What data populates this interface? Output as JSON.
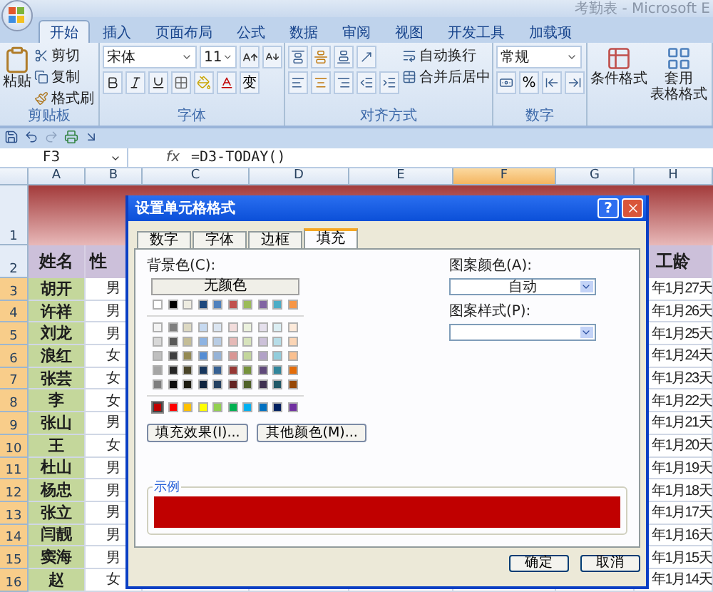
{
  "window": {
    "title": "考勤表 - Microsoft E"
  },
  "ribbon_tabs": [
    {
      "label": "开始",
      "selected": true
    },
    {
      "label": "插入",
      "selected": false
    },
    {
      "label": "页面布局",
      "selected": false
    },
    {
      "label": "公式",
      "selected": false
    },
    {
      "label": "数据",
      "selected": false
    },
    {
      "label": "审阅",
      "selected": false
    },
    {
      "label": "视图",
      "selected": false
    },
    {
      "label": "开发工具",
      "selected": false
    },
    {
      "label": "加载项",
      "selected": false
    }
  ],
  "ribbon": {
    "clipboard": {
      "paste": "粘贴",
      "cut": "剪切",
      "copy": "复制",
      "format_painter": "格式刷",
      "label": "剪贴板"
    },
    "font": {
      "name": "宋体",
      "size": "11",
      "phonetic": "变",
      "label": "字体"
    },
    "alignment": {
      "wrap": "自动换行",
      "merge": "合并后居中",
      "label": "对齐方式"
    },
    "number": {
      "format": "常规",
      "percent": "%",
      "label": "数字"
    },
    "styles": {
      "conditional": "条件格式",
      "table_format": [
        "套用",
        "表格格式"
      ]
    }
  },
  "formula_bar": {
    "cell": "F3",
    "fx": "fx",
    "formula": "=D3-TODAY()"
  },
  "columns": [
    {
      "label": "A",
      "selected": false
    },
    {
      "label": "B",
      "selected": false
    },
    {
      "label": "C",
      "selected": false
    },
    {
      "label": "D",
      "selected": false
    },
    {
      "label": "E",
      "selected": false
    },
    {
      "label": "F",
      "selected": true
    },
    {
      "label": "G",
      "selected": false
    },
    {
      "label": "H",
      "selected": false
    }
  ],
  "title_row": {
    "number": "1"
  },
  "header_row": {
    "number": "2",
    "name": "姓名",
    "gender": "性",
    "tenure": "工龄"
  },
  "rows": [
    {
      "number": "3",
      "selected": true,
      "name": "胡开",
      "gender": "男",
      "tenure": "年1月27天"
    },
    {
      "number": "4",
      "selected": true,
      "name": "许祥",
      "gender": "男",
      "tenure": "年1月26天"
    },
    {
      "number": "5",
      "selected": true,
      "name": "刘龙",
      "gender": "男",
      "tenure": "年1月25天"
    },
    {
      "number": "6",
      "selected": true,
      "name": "浪红",
      "gender": "女",
      "tenure": "年1月24天"
    },
    {
      "number": "7",
      "selected": true,
      "name": "张芸",
      "gender": "女",
      "tenure": "年1月23天"
    },
    {
      "number": "8",
      "selected": true,
      "name": "李",
      "gender": "女",
      "tenure": "年1月22天"
    },
    {
      "number": "9",
      "selected": true,
      "name": "张山",
      "gender": "男",
      "tenure": "年1月21天"
    },
    {
      "number": "10",
      "selected": true,
      "name": "王",
      "gender": "女",
      "tenure": "年1月20天"
    },
    {
      "number": "11",
      "selected": true,
      "name": "杜山",
      "gender": "男",
      "tenure": "年1月19天"
    },
    {
      "number": "12",
      "selected": true,
      "name": "杨忠",
      "gender": "男",
      "tenure": "年1月18天"
    },
    {
      "number": "13",
      "selected": true,
      "name": "张立",
      "gender": "男",
      "tenure": "年1月17天"
    },
    {
      "number": "14",
      "selected": true,
      "name": "闫靓",
      "gender": "男",
      "tenure": "年1月16天"
    },
    {
      "number": "15",
      "selected": true,
      "name": "窦海",
      "gender": "男",
      "tenure": "年1月15天"
    },
    {
      "number": "16",
      "selected": true,
      "name": "赵",
      "gender": "女",
      "tenure": "年1月14天"
    }
  ],
  "dialog": {
    "title": "设置单元格格式",
    "help": "?",
    "tabs": [
      {
        "label": "数字",
        "selected": false
      },
      {
        "label": "字体",
        "selected": false
      },
      {
        "label": "边框",
        "selected": false
      },
      {
        "label": "填充",
        "selected": true
      }
    ],
    "background_label": "背景色(C):",
    "no_color": "无颜色",
    "theme_colors": [
      {
        "color": "#ffffff"
      },
      {
        "color": "#000000"
      },
      {
        "color": "#eeece1"
      },
      {
        "color": "#1f497d"
      },
      {
        "color": "#4f81bd"
      },
      {
        "color": "#c0504d"
      },
      {
        "color": "#9bbb59"
      },
      {
        "color": "#8064a2"
      },
      {
        "color": "#4bacc6"
      },
      {
        "color": "#f79646"
      }
    ],
    "tint_colors": [
      {
        "color": "#f2f2f2"
      },
      {
        "color": "#7f7f7f"
      },
      {
        "color": "#ddd9c3"
      },
      {
        "color": "#c6d9f0"
      },
      {
        "color": "#dbe5f1"
      },
      {
        "color": "#f2dcdb"
      },
      {
        "color": "#ebf1dd"
      },
      {
        "color": "#e5e0ec"
      },
      {
        "color": "#dbeef3"
      },
      {
        "color": "#fdeada"
      },
      {
        "color": "#d8d8d8"
      },
      {
        "color": "#595959"
      },
      {
        "color": "#c4bd97"
      },
      {
        "color": "#8db3e2"
      },
      {
        "color": "#b8cce4"
      },
      {
        "color": "#e5b9b7"
      },
      {
        "color": "#d7e3bc"
      },
      {
        "color": "#ccc1d9"
      },
      {
        "color": "#b7dde8"
      },
      {
        "color": "#fbd5b5"
      },
      {
        "color": "#bfbfbf"
      },
      {
        "color": "#3f3f3f"
      },
      {
        "color": "#938953"
      },
      {
        "color": "#548dd4"
      },
      {
        "color": "#95b3d7"
      },
      {
        "color": "#d99694"
      },
      {
        "color": "#c3d69b"
      },
      {
        "color": "#b2a2c7"
      },
      {
        "color": "#92cddc"
      },
      {
        "color": "#fac08f"
      },
      {
        "color": "#a5a5a5"
      },
      {
        "color": "#262626"
      },
      {
        "color": "#494429"
      },
      {
        "color": "#17365d"
      },
      {
        "color": "#366092"
      },
      {
        "color": "#953734"
      },
      {
        "color": "#76923c"
      },
      {
        "color": "#5f497a"
      },
      {
        "color": "#31859b"
      },
      {
        "color": "#e36c09"
      },
      {
        "color": "#7e7e7e"
      },
      {
        "color": "#0c0c0c"
      },
      {
        "color": "#1d1b10"
      },
      {
        "color": "#0f243e"
      },
      {
        "color": "#244061"
      },
      {
        "color": "#632423"
      },
      {
        "color": "#4f6128"
      },
      {
        "color": "#3f3151"
      },
      {
        "color": "#205867"
      },
      {
        "color": "#974806"
      }
    ],
    "standard_colors": [
      {
        "color": "#c00000",
        "selected": true
      },
      {
        "color": "#ff0000",
        "selected": false
      },
      {
        "color": "#ffc000",
        "selected": false
      },
      {
        "color": "#ffff00",
        "selected": false
      },
      {
        "color": "#92d050",
        "selected": false
      },
      {
        "color": "#00b050",
        "selected": false
      },
      {
        "color": "#00b0f0",
        "selected": false
      },
      {
        "color": "#0070c0",
        "selected": false
      },
      {
        "color": "#002060",
        "selected": false
      },
      {
        "color": "#7030a0",
        "selected": false
      }
    ],
    "fill_effects": "填充效果(I)...",
    "more_colors": "其他颜色(M)...",
    "pattern_color_label": "图案颜色(A):",
    "pattern_color": "自动",
    "pattern_style_label": "图案样式(P):",
    "sample_label": "示例",
    "sample": {
      "color": "#c00000"
    },
    "ok": "确定",
    "cancel": "取消"
  }
}
